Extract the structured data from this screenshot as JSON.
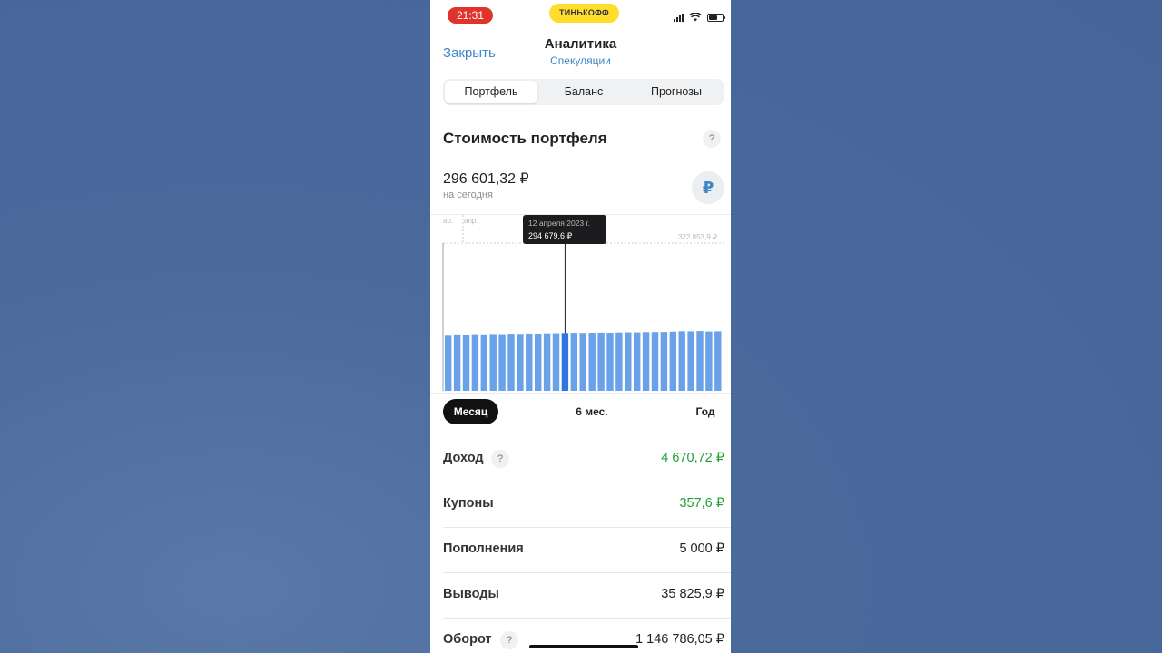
{
  "status_bar": {
    "time": "21:31",
    "brand": "ТИНЬКОФФ"
  },
  "header": {
    "close_label": "Закрыть",
    "title": "Аналитика",
    "subtitle": "Спекуляции"
  },
  "tabs": [
    {
      "label": "Портфель",
      "active": true
    },
    {
      "label": "Баланс",
      "active": false
    },
    {
      "label": "Прогнозы",
      "active": false
    }
  ],
  "portfolio": {
    "title": "Стоимость портфеля",
    "help": "?",
    "value": "296 601,32 ₽",
    "caption": "на сегодня",
    "currency_symbol": "₽"
  },
  "chart_data": {
    "type": "bar",
    "x_tick_labels": [
      "ар.",
      "апр."
    ],
    "max_label": "322 853,9 ₽",
    "values": [
      294100,
      294250,
      294200,
      294300,
      294250,
      294350,
      294300,
      294450,
      294400,
      294500,
      294480,
      294550,
      294600,
      294679.6,
      294720,
      294700,
      294760,
      294800,
      294750,
      294850,
      294900,
      294880,
      294950,
      294980,
      295000,
      295100,
      295250,
      295200,
      295300,
      295150,
      295220
    ],
    "highlight_index": 13,
    "tooltip": {
      "date": "12 апреля 2023 г.",
      "value": "294 679,6 ₽"
    },
    "bar_color": "#6aa2ea",
    "highlight_color": "#2f77e0"
  },
  "periods": {
    "month": "Месяц",
    "six_months": "6 мес.",
    "year": "Год"
  },
  "stats": [
    {
      "label": "Доход",
      "value": "4 670,72 ₽",
      "help": true,
      "green": true
    },
    {
      "label": "Купоны",
      "value": "357,6 ₽",
      "help": false,
      "green": true
    },
    {
      "label": "Пополнения",
      "value": "5 000 ₽",
      "help": false,
      "green": false
    },
    {
      "label": "Выводы",
      "value": "35 825,9 ₽",
      "help": false,
      "green": false
    },
    {
      "label": "Оборот",
      "value": "1 146 786,05 ₽",
      "help": true,
      "green": false
    }
  ],
  "colors": {
    "accent": "#3d87c7",
    "brand_yellow": "#ffdd2d",
    "positive": "#21a038",
    "time_red": "#e0342b"
  }
}
